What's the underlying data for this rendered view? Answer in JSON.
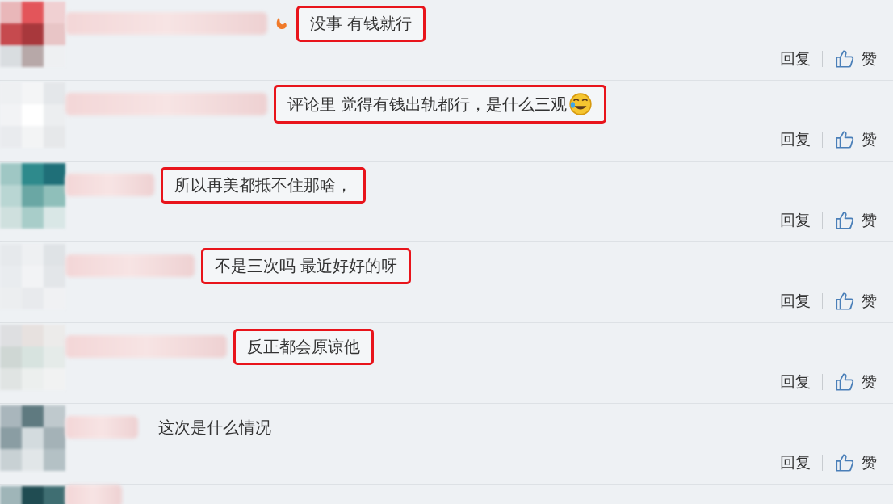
{
  "comments": [
    {
      "text": "没事 有钱就行",
      "highlighted": true,
      "badge": true,
      "emoji": false,
      "reply": "回复",
      "like": "赞"
    },
    {
      "text": "评论里 觉得有钱出轨都行，是什么三观",
      "highlighted": true,
      "badge": false,
      "emoji": true,
      "reply": "回复",
      "like": "赞"
    },
    {
      "text": "所以再美都抵不住那啥，",
      "highlighted": true,
      "badge": false,
      "emoji": false,
      "reply": "回复",
      "like": "赞"
    },
    {
      "text": "不是三次吗 最近好好的呀",
      "highlighted": true,
      "badge": false,
      "emoji": false,
      "reply": "回复",
      "like": "赞"
    },
    {
      "text": "反正都会原谅他",
      "highlighted": true,
      "badge": false,
      "emoji": false,
      "reply": "回复",
      "like": "赞"
    },
    {
      "text": "这次是什么情况",
      "highlighted": false,
      "badge": false,
      "emoji": false,
      "reply": "回复",
      "like": "赞"
    }
  ]
}
